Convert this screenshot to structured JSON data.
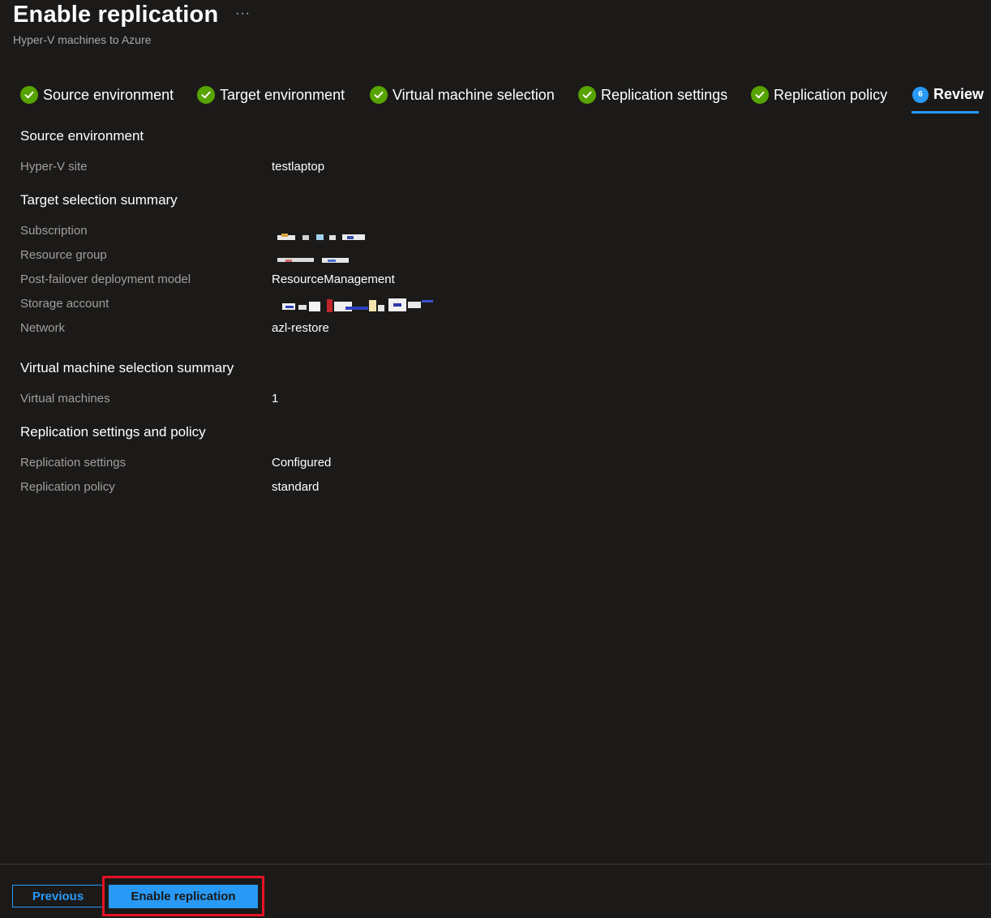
{
  "header": {
    "title": "Enable replication",
    "more_icon": "ellipsis-icon",
    "more_glyph": "···",
    "subtitle": "Hyper-V machines to Azure"
  },
  "steps": [
    {
      "label": "Source environment",
      "status": "complete",
      "icon": "checkmark-icon"
    },
    {
      "label": "Target environment",
      "status": "complete",
      "icon": "checkmark-icon"
    },
    {
      "label": "Virtual machine selection",
      "status": "complete",
      "icon": "checkmark-icon"
    },
    {
      "label": "Replication settings",
      "status": "complete",
      "icon": "checkmark-icon"
    },
    {
      "label": "Replication policy",
      "status": "complete",
      "icon": "checkmark-icon"
    },
    {
      "label": "Review",
      "status": "active",
      "number": "6"
    }
  ],
  "sections": {
    "source": {
      "heading": "Source environment",
      "rows": [
        {
          "label": "Hyper-V site",
          "value": "testlaptop"
        }
      ]
    },
    "target": {
      "heading": "Target selection summary",
      "rows": [
        {
          "label": "Subscription",
          "value": "",
          "redacted": true
        },
        {
          "label": "Resource group",
          "value": "",
          "redacted": true
        },
        {
          "label": "Post-failover deployment model",
          "value": "ResourceManagement"
        },
        {
          "label": "Storage account",
          "value": "",
          "redacted": true
        },
        {
          "label": "Network",
          "value": "azl-restore"
        }
      ]
    },
    "vm": {
      "heading": "Virtual machine selection summary",
      "rows": [
        {
          "label": "Virtual machines",
          "value": "1"
        }
      ]
    },
    "replication": {
      "heading": "Replication settings and policy",
      "rows": [
        {
          "label": "Replication settings",
          "value": "Configured"
        },
        {
          "label": "Replication policy",
          "value": "standard"
        }
      ]
    }
  },
  "footer": {
    "previous_label": "Previous",
    "enable_label": "Enable replication"
  },
  "colors": {
    "background": "#1b1a19",
    "accent": "#2899f5",
    "success": "#57a300",
    "highlight": "#e81123",
    "label_text": "#a19f9d"
  }
}
